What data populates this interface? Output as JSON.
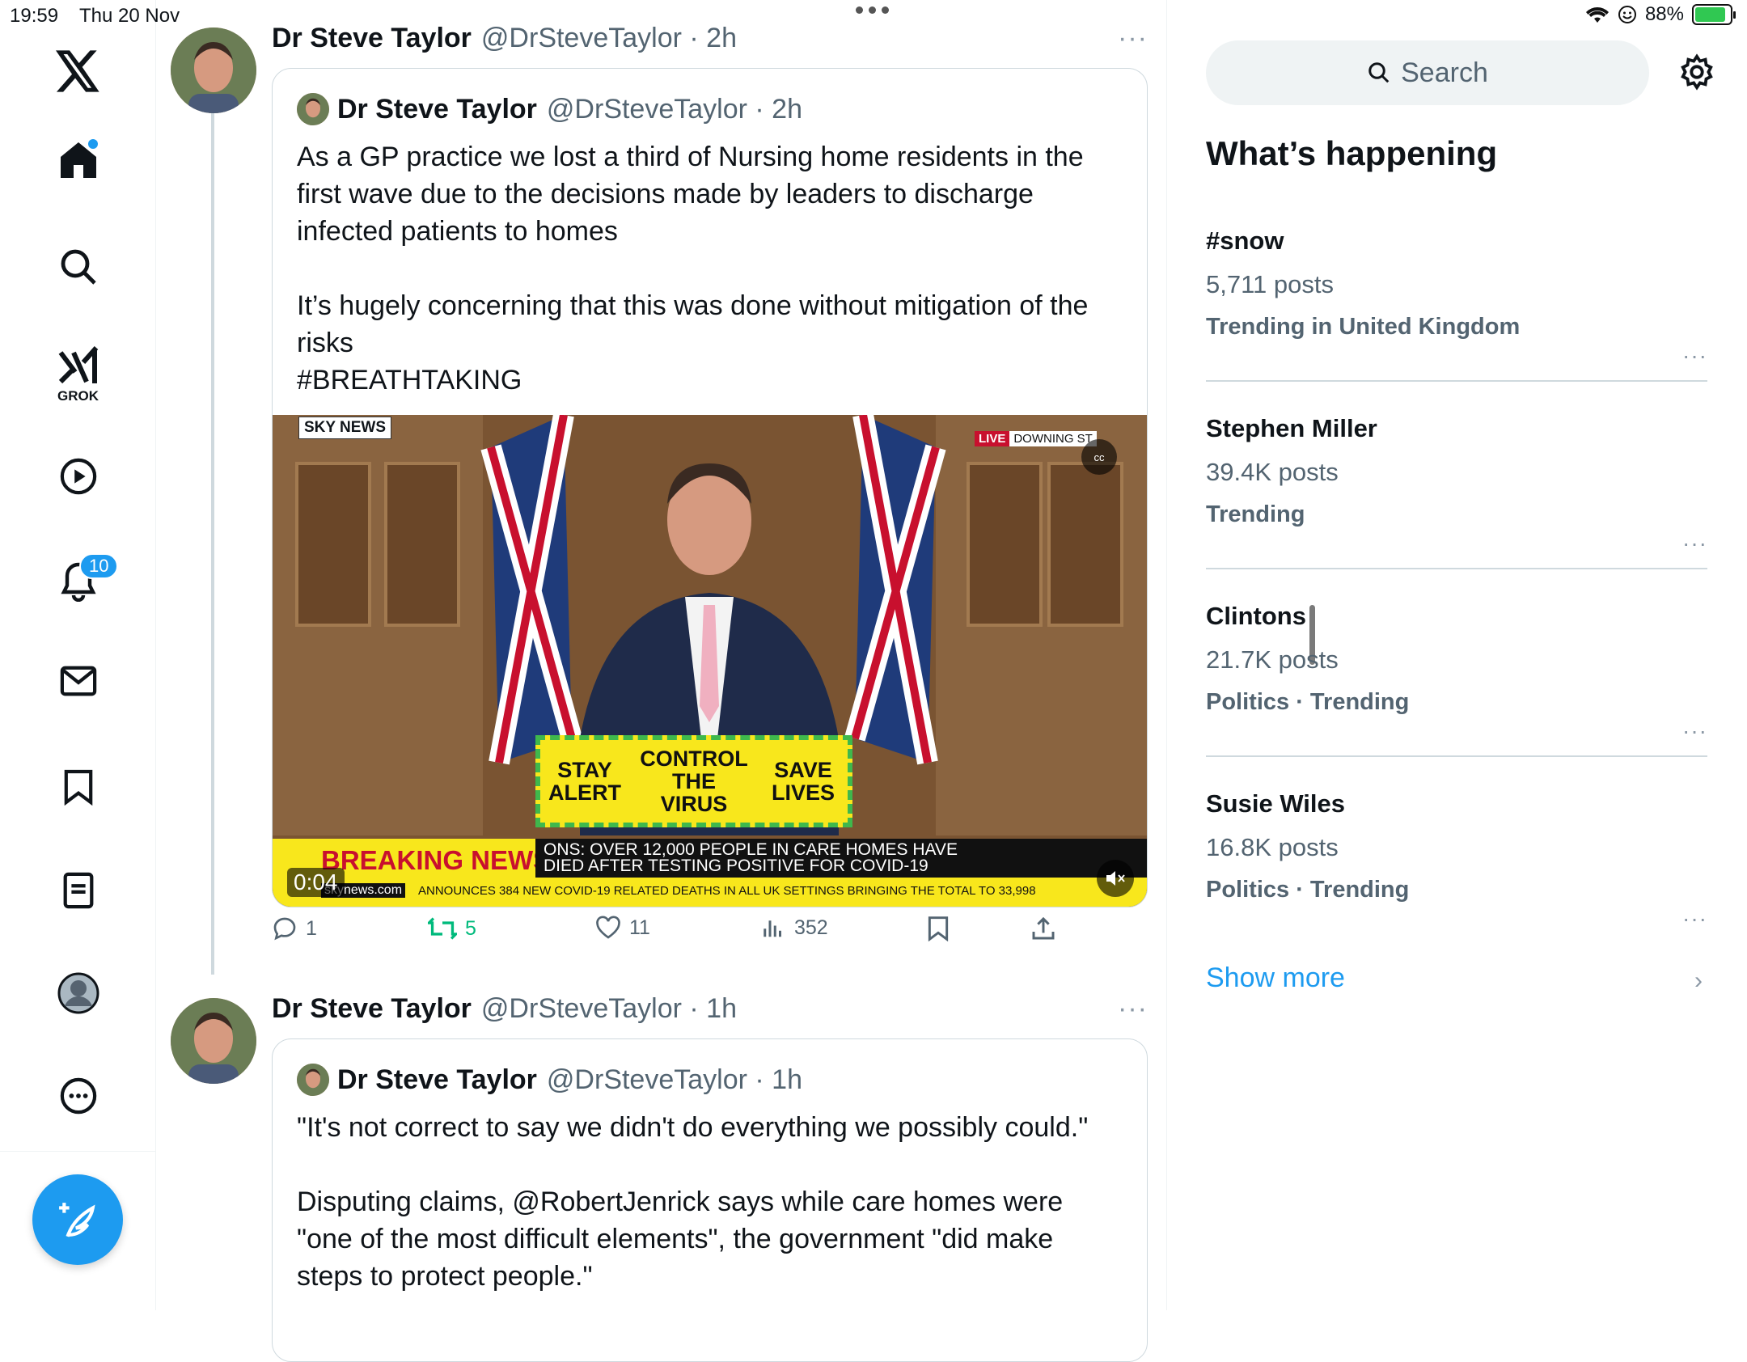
{
  "status_bar": {
    "time": "19:59",
    "date": "Thu 20 Nov",
    "battery": "88%"
  },
  "nav": {
    "grok_label": "GROK",
    "notifications_badge": "10",
    "icons": [
      "x-logo-icon",
      "home-icon",
      "search-icon",
      "grok-icon",
      "video-icon",
      "bell-icon",
      "mail-icon",
      "bookmark-icon",
      "lists-icon",
      "profile-icon",
      "more-icon",
      "compose-icon"
    ]
  },
  "posts": [
    {
      "name": "Dr Steve Taylor",
      "handle": "@DrSteveTaylor · 2h",
      "quote": {
        "name": "Dr Steve Taylor",
        "handle": "@DrSteveTaylor · 2h",
        "text": "As a GP practice we lost a third of Nursing home residents in the first wave due to the decisions made by leaders to discharge infected patients to homes\n\nIt’s hugely concerning that this was done without mitigation of the risks\n#BREATHTAKING",
        "video": {
          "duration": "0:04",
          "channel": "SKY NEWS",
          "live": "LIVE",
          "location": "DOWNING ST",
          "podium": [
            "STAY ALERT",
            "CONTROL THE VIRUS",
            "SAVE LIVES"
          ],
          "breaking": "BREAKING NEWS",
          "headline_1": "ONS: OVER 12,000 PEOPLE IN CARE HOMES HAVE",
          "headline_2": "DIED AFTER TESTING POSITIVE FOR COVID-19",
          "site": "skynews.com",
          "ticker": "ANNOUNCES 384 NEW COVID-19 RELATED DEATHS IN ALL UK SETTINGS BRINGING THE TOTAL TO 33,998"
        }
      },
      "stats": {
        "replies": "1",
        "reposts": "5",
        "likes": "11",
        "views": "352"
      }
    },
    {
      "name": "Dr Steve Taylor",
      "handle": "@DrSteveTaylor · 1h",
      "quote": {
        "name": "Dr Steve Taylor",
        "handle": "@DrSteveTaylor · 1h",
        "text": "\"It's not correct to say we didn't do everything we possibly could.\"\n\nDisputing claims, @RobertJenrick says while care homes were \"one of the most difficult elements\", the government \"did make steps to protect people.\""
      }
    }
  ],
  "sidebar": {
    "search_placeholder": "Search",
    "heading": "What’s happening",
    "trends": [
      {
        "title": "#snow",
        "count": "5,711 posts",
        "context": "Trending in United Kingdom"
      },
      {
        "title": "Stephen Miller",
        "count": "39.4K posts",
        "context": "Trending"
      },
      {
        "title": "Clintons",
        "count": "21.7K posts",
        "context": "Politics · Trending"
      },
      {
        "title": "Susie Wiles",
        "count": "16.8K posts",
        "context": "Politics · Trending"
      }
    ],
    "show_more": "Show more"
  },
  "colors": {
    "accent": "#1d9bf0",
    "repost": "#00ba7c",
    "text": "#0f1419",
    "muted": "#536471"
  }
}
